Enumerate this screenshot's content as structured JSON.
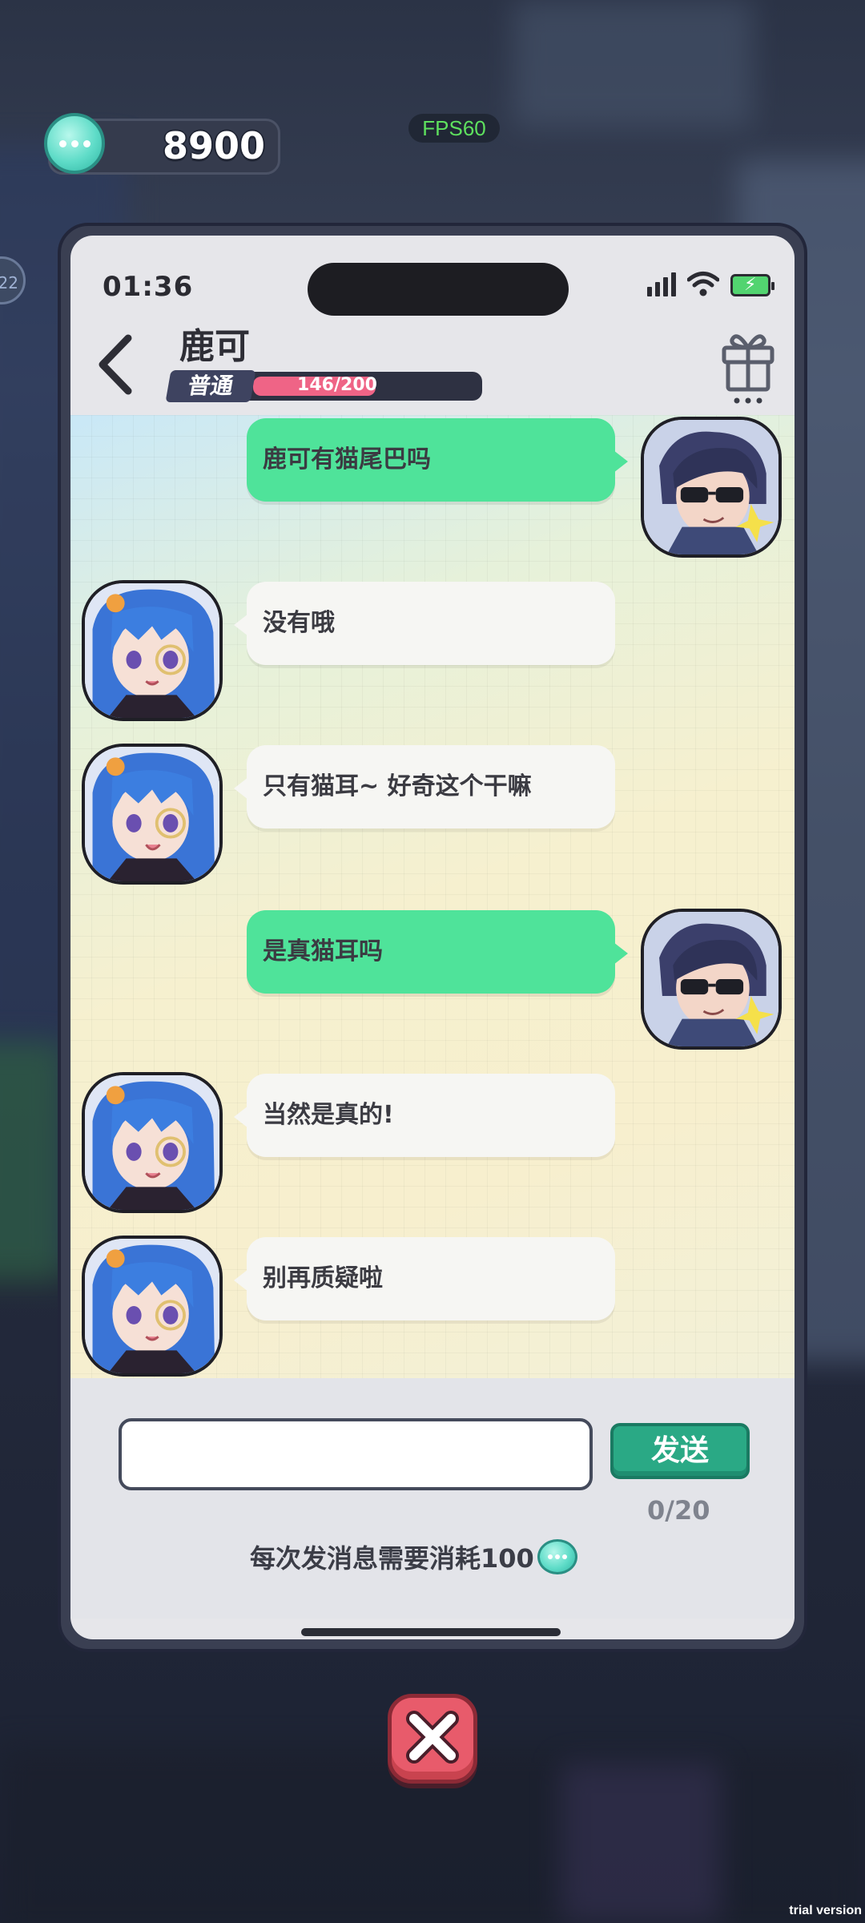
{
  "hud": {
    "currency_value": "8900",
    "currency_icon": "chat-bubble-coin-icon",
    "fps_label": "FPS60",
    "side_badge": "22"
  },
  "phone": {
    "status_time": "01:36",
    "contact_name": "鹿可",
    "relationship": {
      "tier": "普通",
      "progress_text": "146/200",
      "current": 146,
      "max": 200
    },
    "messages": [
      {
        "from": "player",
        "text": "鹿可有猫尾巴吗"
      },
      {
        "from": "npc",
        "text": "没有哦"
      },
      {
        "from": "npc",
        "text": "只有猫耳~ 好奇这个干嘛"
      },
      {
        "from": "player",
        "text": "是真猫耳吗"
      },
      {
        "from": "npc",
        "text": "当然是真的!"
      },
      {
        "from": "npc",
        "text": "别再质疑啦"
      }
    ],
    "input": {
      "value": "",
      "placeholder": "",
      "send_label": "发送",
      "char_count": "0/20"
    },
    "cost_note": "每次发消息需要消耗100"
  },
  "watermark": "trial version",
  "colors": {
    "player_bubble": "#4fe39a",
    "npc_bubble": "#f6f6f3",
    "send_button": "#2aa985",
    "level_fill": "#ef6486",
    "close_button": "#e85b6b"
  }
}
